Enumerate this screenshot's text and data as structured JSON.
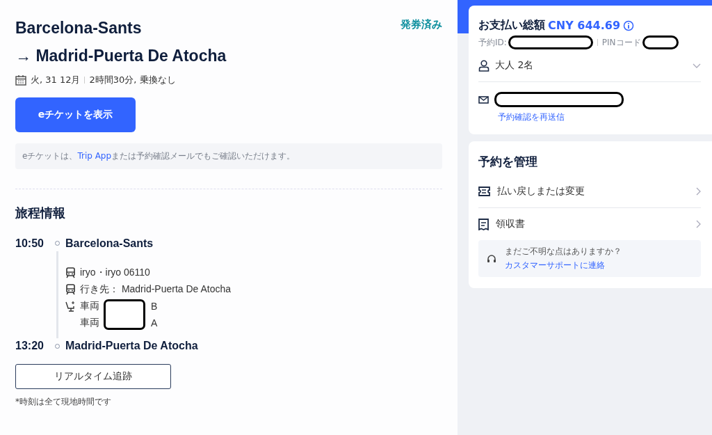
{
  "trip": {
    "origin": "Barcelona-Sants",
    "destination_arrow": "→",
    "destination": "Madrid-Puerta De Atocha",
    "status": "発券済み",
    "date": "火, 31 12月",
    "duration": "2時間30分, 乗換なし",
    "eticket_button": "eチケットを表示",
    "note_before": "eチケットは、",
    "note_link": "Trip App",
    "note_after": "または予約確認メールでもご確認いただけます。"
  },
  "itinerary": {
    "title": "旅程情報",
    "departure": {
      "time": "10:50",
      "station": "Barcelona-Sants"
    },
    "details": [
      {
        "kind": "train",
        "text": "iryo・iryo 06110"
      },
      {
        "kind": "train",
        "text": "行き先： Madrid-Puerta De Atocha"
      },
      {
        "kind": "seat",
        "label": "車両",
        "value": "B"
      },
      {
        "kind": "seat-plain",
        "label": "車両",
        "value": "A"
      }
    ],
    "arrival": {
      "time": "13:20",
      "station": "Madrid-Puerta De Atocha"
    },
    "tracking_button": "リアルタイム追跡",
    "footnote": "*時刻は全て現地時間です"
  },
  "payment": {
    "label": "お支払い総額",
    "amount": "CNY 644.69",
    "booking_id_label": "予約ID:",
    "pin_label": "PINコード",
    "passengers": "大人 2名",
    "resend_link": "予約確認を再送信"
  },
  "manage": {
    "title": "予約を管理",
    "items": [
      {
        "kind": "refund",
        "label": "払い戻しまたは変更"
      },
      {
        "kind": "receipt",
        "label": "領収書"
      }
    ],
    "help_text": "まだご不明な点はありますか？",
    "help_link": "カスタマーサポートに連絡"
  }
}
